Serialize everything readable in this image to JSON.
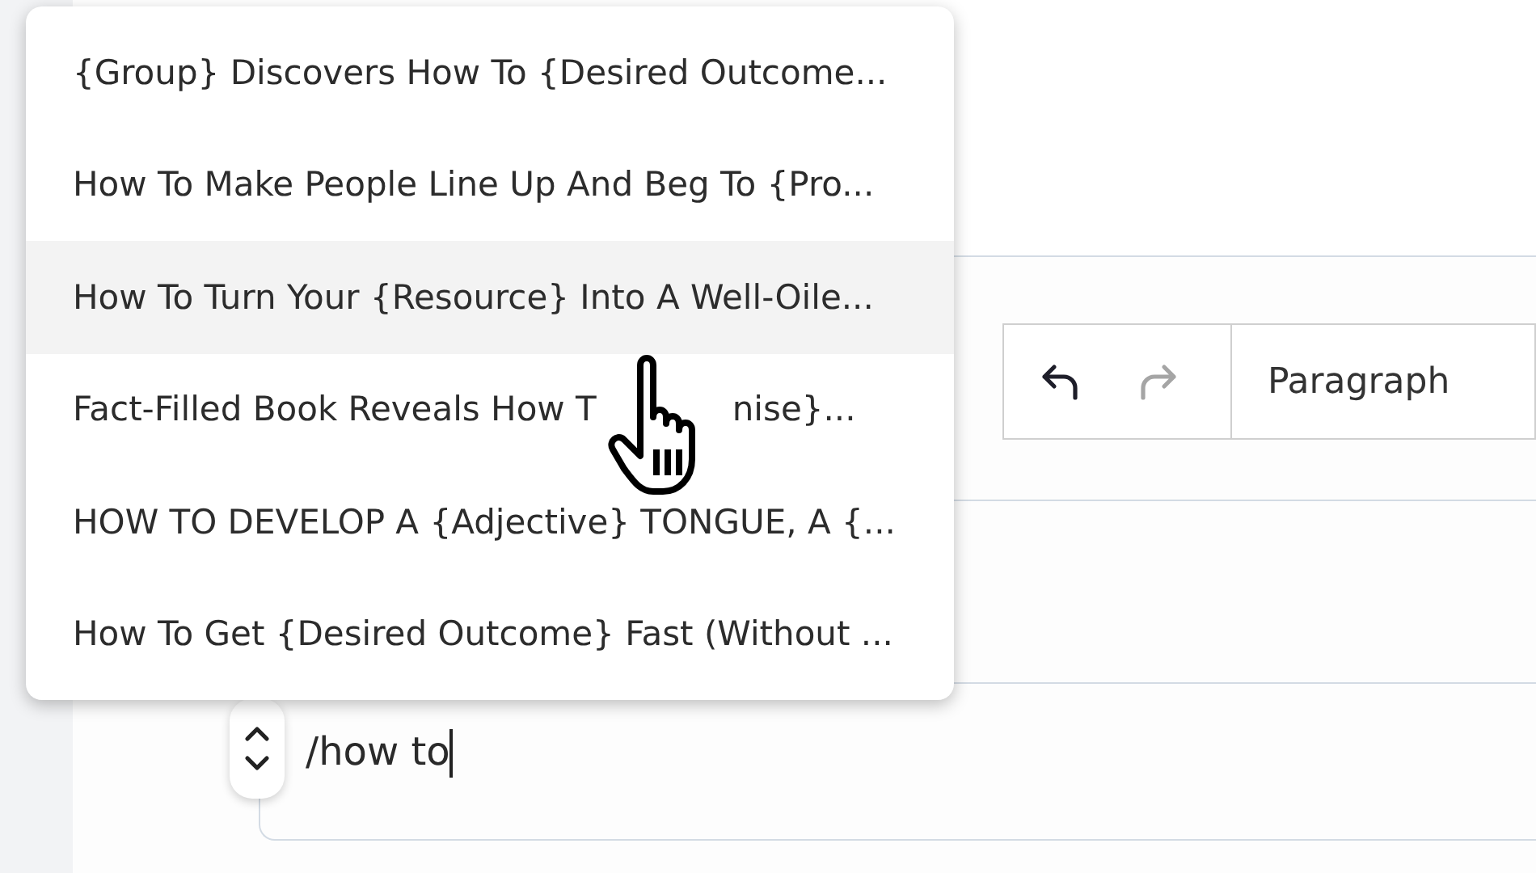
{
  "menu": {
    "items": [
      {
        "text": "{Group} Discovers How To {Desired Outcome...",
        "selected": false
      },
      {
        "text": "How To Make People Line Up And Beg To {Pro...",
        "selected": false
      },
      {
        "text": "How To Turn Your {Resource} Into A Well-Oile...",
        "selected": true
      },
      {
        "text": "Fact-Filled Book Reveals How T",
        "tail": "nise}...",
        "selected": false
      },
      {
        "text": "HOW TO DEVELOP A {Adjective} TONGUE, A {...",
        "selected": false
      },
      {
        "text": "How To Get {Desired Outcome} Fast (Without ...",
        "selected": false
      }
    ]
  },
  "toolbar": {
    "undo_disabled": false,
    "redo_disabled": true,
    "block_type": "Paragraph"
  },
  "editor": {
    "block_text": "/how to"
  }
}
